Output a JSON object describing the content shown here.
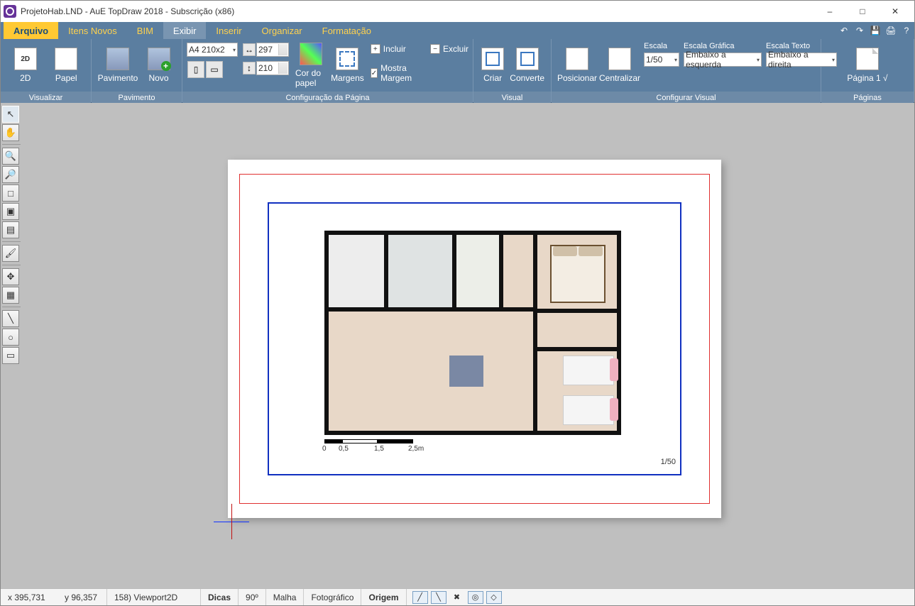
{
  "title": "ProjetoHab.LND - AuE TopDraw 2018  - Subscrição (x86)",
  "menu": {
    "file": "Arquivo",
    "items": [
      {
        "label": "Itens Novos"
      },
      {
        "label": "BIM"
      },
      {
        "label": "Exibir",
        "active": true
      },
      {
        "label": "Inserir"
      },
      {
        "label": "Organizar"
      },
      {
        "label": "Formatação"
      }
    ]
  },
  "ribbon": {
    "visualizar": {
      "label": "Visualizar",
      "btn2d": "2D",
      "papel": "Papel"
    },
    "pavimento": {
      "label": "Pavimento",
      "pav": "Pavimento",
      "novo": "Novo"
    },
    "config_pagina": {
      "label": "Configuração da Página",
      "paper_size": "A4 210x2",
      "width": "297",
      "height": "210",
      "cor_do_papel": "Cor do papel",
      "margens": "Margens",
      "incluir": "Incluir",
      "excluir": "Excluir",
      "mostra_margem": "Mostra Margem"
    },
    "visual": {
      "label": "Visual",
      "criar": "Criar",
      "converte": "Converte"
    },
    "config_visual": {
      "label": "Configurar Visual",
      "posicionar": "Posicionar",
      "centralizar": "Centralizar",
      "escala_lbl": "Escala",
      "escala_val": "1/50",
      "escala_graf_lbl": "Escala Gráfica",
      "escala_graf_val": "Embaixo a esquerda",
      "escala_texto_lbl": "Escala Texto",
      "escala_texto_val": "Embaixo a direita"
    },
    "paginas": {
      "label": "Páginas",
      "pagina_btn": "Página 1 √"
    }
  },
  "scale": {
    "t0": "0",
    "t1": "0,5",
    "t2": "1,5",
    "t3": "2,5m",
    "ratio": "1/50"
  },
  "status": {
    "x": "x 395,731",
    "y": "y 96,357",
    "layer": "158) Viewport2D",
    "dicas": "Dicas",
    "angle": "90º",
    "malha": "Malha",
    "foto": "Fotográfico",
    "origem": "Origem"
  }
}
